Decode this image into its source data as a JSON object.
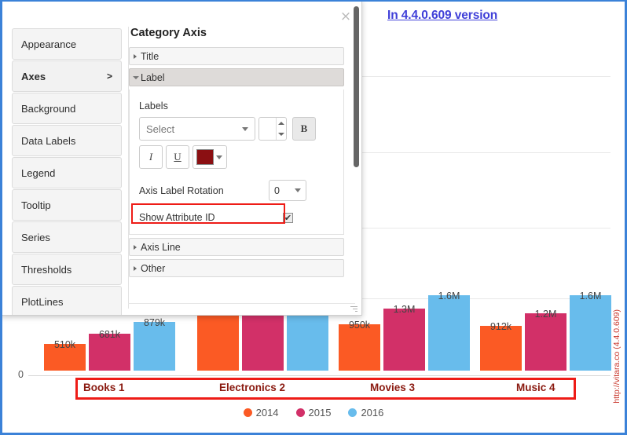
{
  "chart_title": "In 4.4.0.609 version",
  "watermark": "http://vitara.co  (4.4.0.609)",
  "dialog": {
    "close_icon": "×",
    "sidebar": [
      {
        "label": "Appearance",
        "chevron": ""
      },
      {
        "label": "Axes",
        "chevron": ">"
      },
      {
        "label": "Background",
        "chevron": ""
      },
      {
        "label": "Data Labels",
        "chevron": ""
      },
      {
        "label": "Legend",
        "chevron": ""
      },
      {
        "label": "Tooltip",
        "chevron": ""
      },
      {
        "label": "Series",
        "chevron": ""
      },
      {
        "label": "Thresholds",
        "chevron": ""
      },
      {
        "label": "PlotLines",
        "chevron": ""
      }
    ],
    "panel_heading": "Category Axis",
    "accordions": {
      "title": "Title",
      "label": "Label",
      "axis_line": "Axis Line",
      "other": "Other"
    },
    "label_section": {
      "labels_caption": "Labels",
      "font_select_value": "Select",
      "font_size_value": "",
      "bold_label": "B",
      "italic_label": "I",
      "underline_label": "U",
      "color_value": "#8B0F12",
      "rotation_label": "Axis Label Rotation",
      "rotation_value": "0",
      "show_attribute_id_label": "Show Attribute ID",
      "show_attribute_id_checked": "✔"
    }
  },
  "chart_data": {
    "type": "bar",
    "title": "In 4.4.0.609 version",
    "xlabel": "",
    "ylabel": "",
    "ylim": [
      0,
      1800000
    ],
    "grid": true,
    "legend_position": "bottom",
    "categories": [
      "Books 1",
      "Electronics 2",
      "Movies 3",
      "Music 4"
    ],
    "series": [
      {
        "name": "2014",
        "color": "#FB5A24",
        "values": [
          510000,
          1900000,
          950000,
          912000
        ],
        "labels": [
          "510k",
          "",
          "950k",
          "912k"
        ]
      },
      {
        "name": "2015",
        "color": "#D23068",
        "values": [
          681000,
          2000000,
          1300000,
          1200000
        ],
        "labels": [
          "681k",
          "",
          "1.3M",
          "1.2M"
        ]
      },
      {
        "name": "2016",
        "color": "#68BCEC",
        "values": [
          879000,
          2000000,
          1600000,
          1600000
        ],
        "labels": [
          "879k",
          "",
          "1.6M",
          "1.6M"
        ]
      }
    ],
    "y_tick_labels": [
      "0"
    ],
    "axis_label_color": "#8a1a10"
  }
}
